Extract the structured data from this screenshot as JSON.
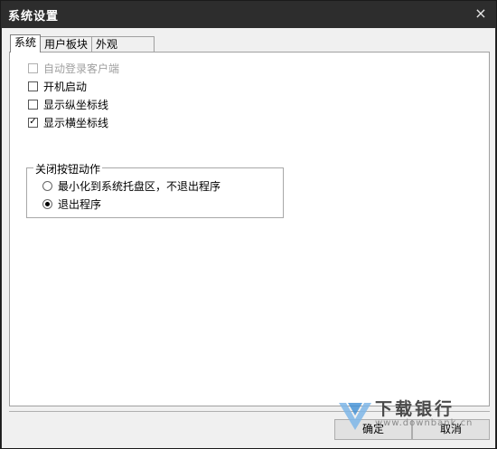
{
  "window": {
    "title": "系统设置",
    "close_glyph": "×"
  },
  "tabs": [
    {
      "label": "系统",
      "active": true
    },
    {
      "label": "用户板块",
      "active": false
    },
    {
      "label": "外观",
      "active": false
    }
  ],
  "options": {
    "auto_login": {
      "label": "自动登录客户端",
      "checked": false,
      "disabled": true,
      "mark": ""
    },
    "startup": {
      "label": "开机启动",
      "checked": false,
      "disabled": false,
      "mark": ""
    },
    "vertical_lines": {
      "label": "显示纵坐标线",
      "checked": false,
      "disabled": false,
      "mark": ""
    },
    "horizontal_lines": {
      "label": "显示横坐标线",
      "checked": true,
      "disabled": false,
      "mark": "✓"
    }
  },
  "close_action": {
    "title": "关闭按钮动作",
    "minimize": {
      "label": "最小化到系统托盘区，不退出程序",
      "selected": false
    },
    "exit": {
      "label": "退出程序",
      "selected": true
    }
  },
  "buttons": {
    "ok": "确定",
    "cancel": "取消"
  },
  "watermark": {
    "text": "下载银行",
    "url": "www.downbank.cn"
  }
}
